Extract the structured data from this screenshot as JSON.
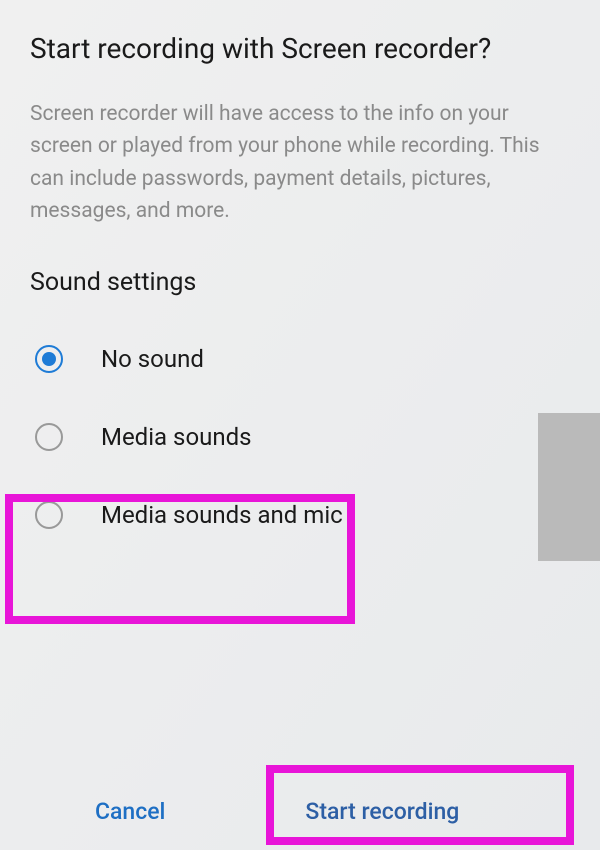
{
  "dialog": {
    "title": "Start recording with Screen recorder?",
    "description": "Screen recorder will have access to the info on your screen or played from your phone while recording. This can include passwords, payment details, pictures, messages, and more.",
    "sound_section_header": "Sound settings",
    "options": {
      "no_sound": "No sound",
      "media_sounds": "Media sounds",
      "media_and_mic": "Media sounds and mic"
    },
    "selected_option": "no_sound",
    "buttons": {
      "cancel": "Cancel",
      "start": "Start recording"
    }
  }
}
